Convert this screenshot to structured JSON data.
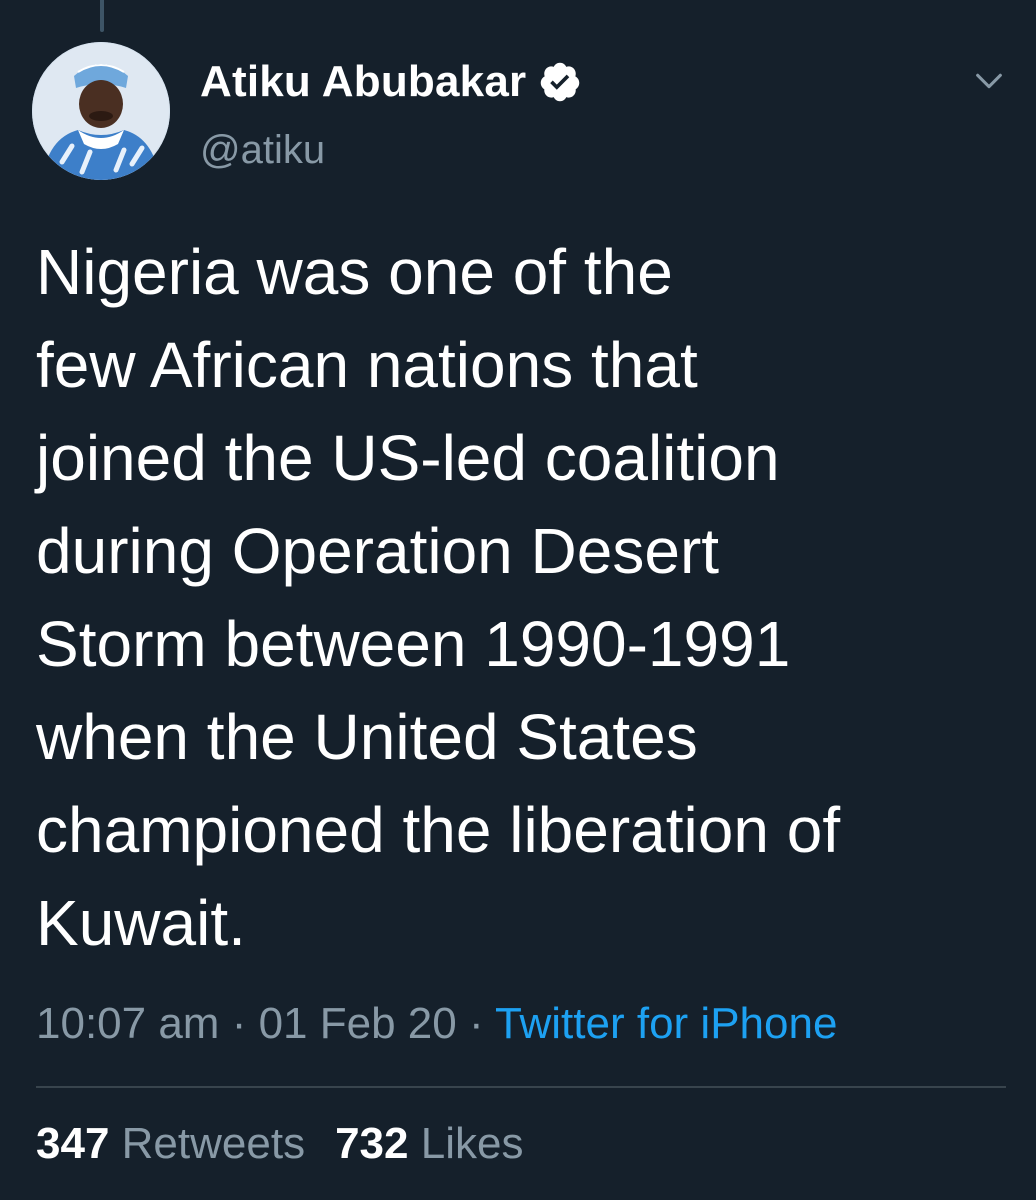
{
  "author": {
    "display_name": "Atiku Abubakar",
    "handle": "@atiku",
    "verified": true,
    "avatar_icon": "profile-photo"
  },
  "tweet": {
    "text": "Nigeria was one of the\nfew African nations that\njoined the US-led coalition\nduring Operation Desert\nStorm between 1990-1991\nwhen the United States\nchampioned the liberation of\nKuwait."
  },
  "meta": {
    "time": "10:07 am",
    "separator": " · ",
    "date": "01 Feb 20",
    "source": "Twitter for iPhone"
  },
  "stats": {
    "retweets_count": "347",
    "retweets_label": "Retweets",
    "likes_count": "732",
    "likes_label": "Likes"
  },
  "colors": {
    "background": "#15202b",
    "text": "#ffffff",
    "muted": "#8899a6",
    "link": "#1da1f2",
    "divider": "#38444d"
  }
}
